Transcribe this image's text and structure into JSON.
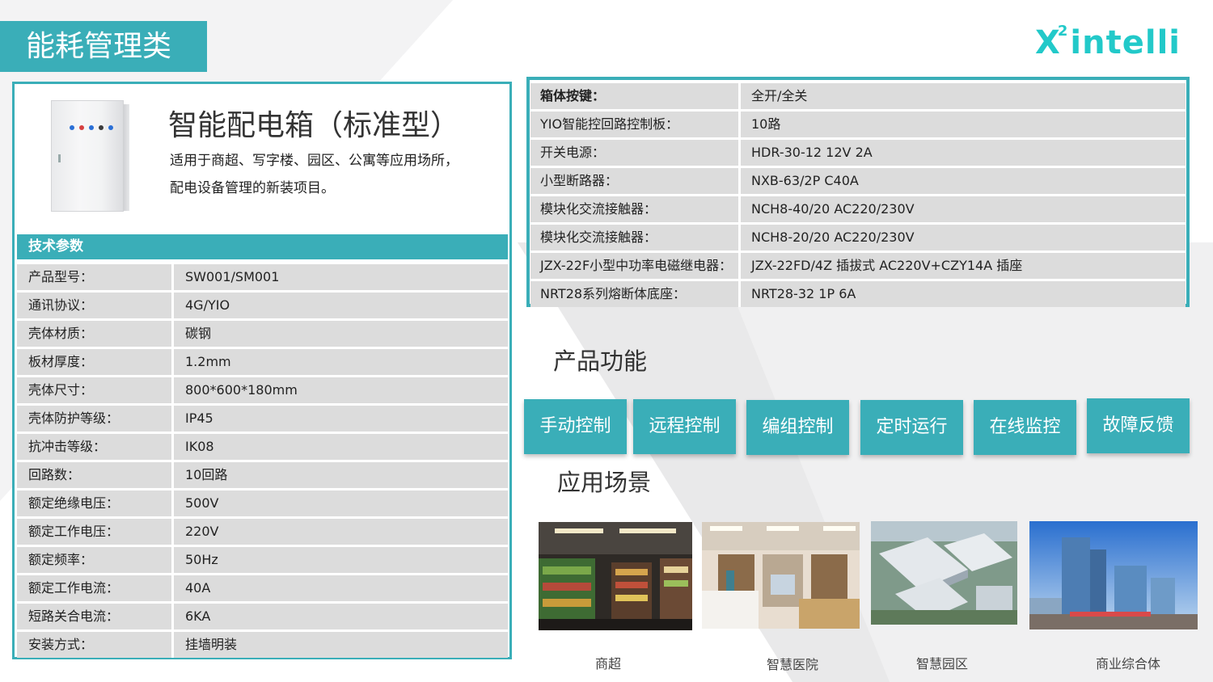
{
  "page_title": "能耗管理类",
  "logo": {
    "main": "X",
    "sup": "2",
    "rest": "intelli"
  },
  "product": {
    "title": "智能配电箱（标准型）",
    "desc_line1": "适用于商超、写字楼、园区、公寓等应用场所，",
    "desc_line2": "配电设备管理的新装项目。",
    "indicator_colors": [
      "#2a6fd6",
      "#d64040",
      "#2a6fd6",
      "#3b3b3b",
      "#2a6fd6"
    ]
  },
  "params": {
    "header": "技术参数",
    "rows": [
      {
        "k": "产品型号：",
        "v": "SW001/SM001"
      },
      {
        "k": "通讯协议：",
        "v": "4G/YIO"
      },
      {
        "k": "壳体材质：",
        "v": "碳钢"
      },
      {
        "k": "板材厚度：",
        "v": "1.2mm"
      },
      {
        "k": "壳体尺寸：",
        "v": "800*600*180mm"
      },
      {
        "k": "壳体防护等级：",
        "v": "IP45"
      },
      {
        "k": "抗冲击等级：",
        "v": "IK08"
      },
      {
        "k": "回路数：",
        "v": "10回路"
      },
      {
        "k": "额定绝缘电压：",
        "v": "500V"
      },
      {
        "k": "额定工作电压：",
        "v": "220V"
      },
      {
        "k": "额定频率：",
        "v": "50Hz"
      },
      {
        "k": "额定工作电流：",
        "v": "40A"
      },
      {
        "k": "短路关合电流：",
        "v": "6KA"
      },
      {
        "k": "安装方式：",
        "v": "挂墙明装"
      }
    ]
  },
  "specs": {
    "rows": [
      {
        "k": "箱体按键：",
        "v": "全开/全关"
      },
      {
        "k": "YIO智能控回路控制板：",
        "v": "10路"
      },
      {
        "k": "开关电源：",
        "v": "HDR-30-12 12V 2A"
      },
      {
        "k": "小型断路器：",
        "v": "NXB-63/2P C40A"
      },
      {
        "k": "模块化交流接触器：",
        "v": "NCH8-40/20 AC220/230V"
      },
      {
        "k": "模块化交流接触器：",
        "v": "NCH8-20/20 AC220/230V"
      },
      {
        "k": "JZX-22F小型中功率电磁继电器：",
        "v": "JZX-22FD/4Z 插拔式 AC220V+CZY14A 插座"
      },
      {
        "k": "NRT28系列熔断体底座：",
        "v": "NRT28-32 1P 6A"
      }
    ]
  },
  "features": {
    "heading": "产品功能",
    "buttons": [
      "手动控制",
      "远程控制",
      "编组控制",
      "定时运行",
      "在线监控",
      "故障反馈"
    ]
  },
  "scenes": {
    "heading": "应用场景",
    "items": [
      "商超",
      "智慧医院",
      "智慧园区",
      "商业综合体"
    ]
  },
  "colors": {
    "accent": "#3aaeb8",
    "row_bg": "#dcdcdc",
    "logo": "#22c9c9"
  }
}
